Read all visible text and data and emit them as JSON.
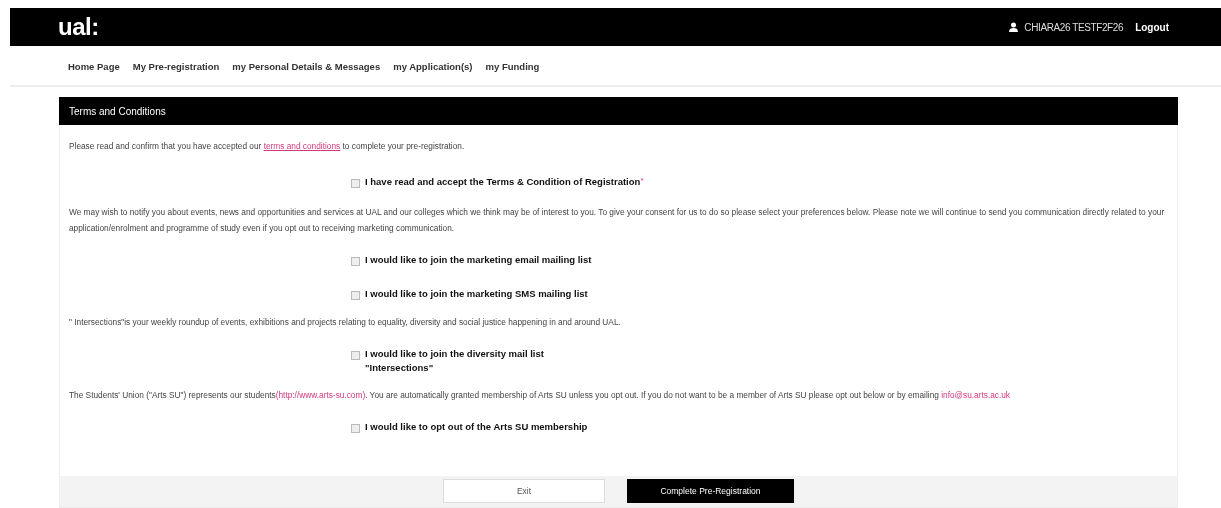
{
  "header": {
    "logo": "ual:",
    "user_name": "CHIARA26 TESTF2F26",
    "logout": "Logout"
  },
  "nav": [
    {
      "label": "Home Page"
    },
    {
      "label": "My Pre-registration"
    },
    {
      "label": "my Personal Details & Messages"
    },
    {
      "label": "my Application(s)"
    },
    {
      "label": "my Funding"
    }
  ],
  "panel": {
    "title": "Terms and Conditions",
    "content": [
      {
        "kind": "paragraph",
        "segments": [
          {
            "kind": "text",
            "text": "Please read and confirm that you have accepted our "
          },
          {
            "kind": "link",
            "text": "terms and conditions"
          },
          {
            "kind": "text",
            "text": " to complete your pre-registration."
          }
        ]
      },
      {
        "kind": "checkbox",
        "label": "I have read and accept the Terms & Condition of Registration",
        "required_mark": "*",
        "checked": false
      },
      {
        "kind": "paragraph",
        "segments": [
          {
            "kind": "text",
            "text": "We may wish to notify you about events, news and opportunities and services at UAL and our colleges which we think may be of interest to you. To give your consent for us to do so please select your preferences below. Please note we will continue to send you communication directly related to your application/enrolment and programme of study even if you opt out to receiving marketing communication."
          }
        ]
      },
      {
        "kind": "checkbox",
        "label": "I would like to join the marketing email mailing list",
        "checked": false
      },
      {
        "kind": "checkbox",
        "label": "I would like to join the marketing SMS mailing list",
        "checked": false
      },
      {
        "kind": "paragraph",
        "segments": [
          {
            "kind": "text",
            "text": "\" Intersections\"is your weekly roundup of events, exhibitions and projects relating to equality, diversity and social justice happening in and around UAL."
          }
        ]
      },
      {
        "kind": "checkbox",
        "label": "I would like to join the diversity mail list",
        "sublabel": "\"Intersections\"",
        "checked": false
      },
      {
        "kind": "paragraph",
        "segments": [
          {
            "kind": "text",
            "text": "The Students' Union (\"Arts SU\") represents our students"
          },
          {
            "kind": "link",
            "text": "(http://www.arts-su.com)"
          },
          {
            "kind": "text",
            "text": ". You are automatically granted membership of Arts SU unless you opt out. If you do not want to be a member of Arts SU please opt out below or by emailing "
          },
          {
            "kind": "link",
            "text": "info@su.arts.ac.uk"
          }
        ]
      },
      {
        "kind": "checkbox",
        "label": "I would like to opt out of the Arts SU membership",
        "checked": false
      }
    ],
    "buttons": [
      {
        "kind": "secondary",
        "label": "Exit"
      },
      {
        "kind": "primary",
        "label": "Complete Pre-Registration"
      }
    ]
  }
}
